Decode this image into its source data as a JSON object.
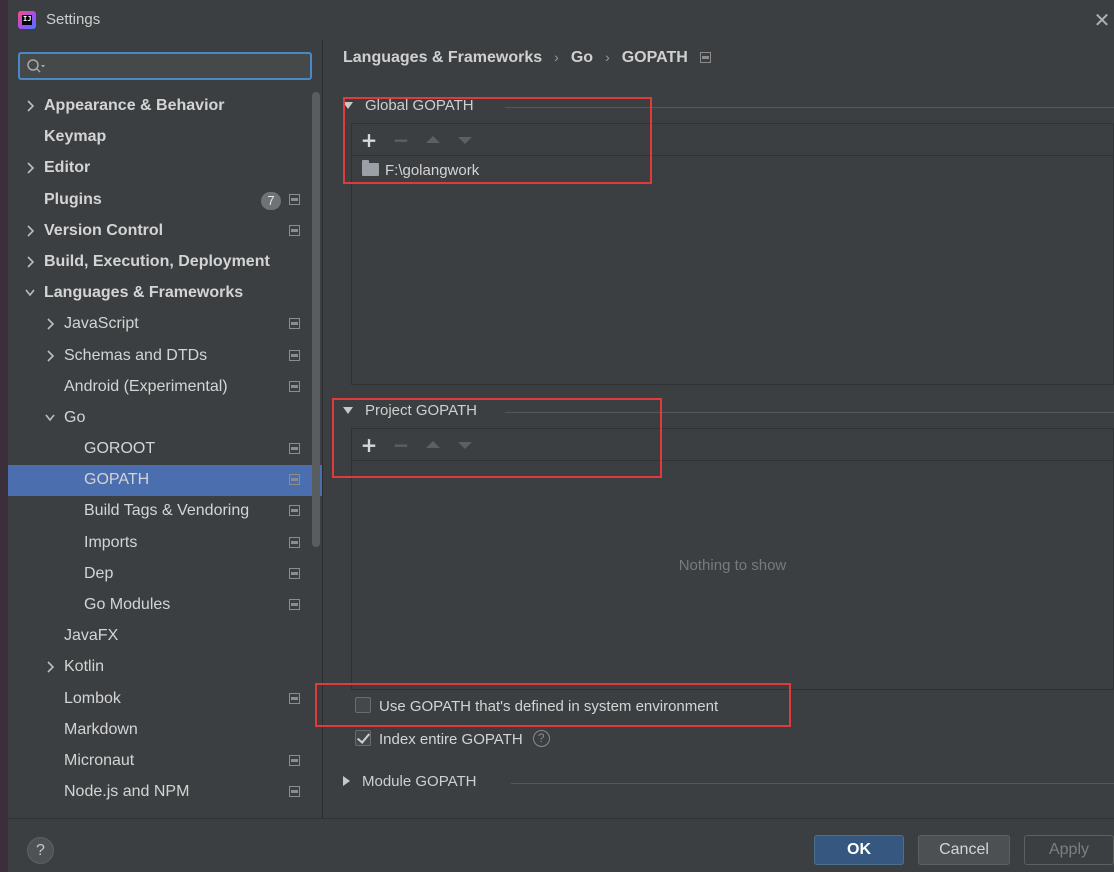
{
  "window": {
    "title": "Settings",
    "logo_text": "IJ"
  },
  "search": {
    "value": "",
    "placeholder": ""
  },
  "sidebar": {
    "items": [
      {
        "label": "Appearance & Behavior",
        "level": 0,
        "arrow": "right",
        "bold": true,
        "proj_icon": false
      },
      {
        "label": "Keymap",
        "level": 0,
        "arrow": "none",
        "bold": true,
        "proj_icon": false
      },
      {
        "label": "Editor",
        "level": 0,
        "arrow": "right",
        "bold": true,
        "proj_icon": false
      },
      {
        "label": "Plugins",
        "level": 0,
        "arrow": "none",
        "bold": true,
        "proj_icon": true,
        "badge": "7"
      },
      {
        "label": "Version Control",
        "level": 0,
        "arrow": "right",
        "bold": true,
        "proj_icon": true
      },
      {
        "label": "Build, Execution, Deployment",
        "level": 0,
        "arrow": "right",
        "bold": true,
        "proj_icon": false
      },
      {
        "label": "Languages & Frameworks",
        "level": 0,
        "arrow": "down",
        "bold": true,
        "proj_icon": false
      },
      {
        "label": "JavaScript",
        "level": 1,
        "arrow": "right",
        "bold": false,
        "proj_icon": true
      },
      {
        "label": "Schemas and DTDs",
        "level": 1,
        "arrow": "right",
        "bold": false,
        "proj_icon": true
      },
      {
        "label": "Android (Experimental)",
        "level": 1,
        "arrow": "none",
        "bold": false,
        "proj_icon": true
      },
      {
        "label": "Go",
        "level": 1,
        "arrow": "down",
        "bold": false,
        "proj_icon": false
      },
      {
        "label": "GOROOT",
        "level": 2,
        "arrow": "none",
        "bold": false,
        "proj_icon": true
      },
      {
        "label": "GOPATH",
        "level": 2,
        "arrow": "none",
        "bold": false,
        "proj_icon": true,
        "selected": true
      },
      {
        "label": "Build Tags & Vendoring",
        "level": 2,
        "arrow": "none",
        "bold": false,
        "proj_icon": true
      },
      {
        "label": "Imports",
        "level": 2,
        "arrow": "none",
        "bold": false,
        "proj_icon": true
      },
      {
        "label": "Dep",
        "level": 2,
        "arrow": "none",
        "bold": false,
        "proj_icon": true
      },
      {
        "label": "Go Modules",
        "level": 2,
        "arrow": "none",
        "bold": false,
        "proj_icon": true
      },
      {
        "label": "JavaFX",
        "level": 1,
        "arrow": "none",
        "bold": false,
        "proj_icon": false
      },
      {
        "label": "Kotlin",
        "level": 1,
        "arrow": "right",
        "bold": false,
        "proj_icon": false
      },
      {
        "label": "Lombok",
        "level": 1,
        "arrow": "none",
        "bold": false,
        "proj_icon": true
      },
      {
        "label": "Markdown",
        "level": 1,
        "arrow": "none",
        "bold": false,
        "proj_icon": false
      },
      {
        "label": "Micronaut",
        "level": 1,
        "arrow": "none",
        "bold": false,
        "proj_icon": true
      },
      {
        "label": "Node.js and NPM",
        "level": 1,
        "arrow": "none",
        "bold": false,
        "proj_icon": true
      }
    ]
  },
  "breadcrumb": {
    "items": [
      "Languages & Frameworks",
      "Go",
      "GOPATH"
    ]
  },
  "global_gopath": {
    "title": "Global GOPATH",
    "entries": [
      "F:\\golangwork"
    ]
  },
  "project_gopath": {
    "title": "Project GOPATH",
    "empty_text": "Nothing to show"
  },
  "options": {
    "use_system_env_label": "Use GOPATH that's defined in system environment",
    "use_system_env_checked": false,
    "index_entire_label": "Index entire GOPATH",
    "index_entire_checked": true
  },
  "module_gopath": {
    "title": "Module GOPATH"
  },
  "footer": {
    "help": "?",
    "ok": "OK",
    "cancel": "Cancel",
    "apply": "Apply"
  },
  "colors": {
    "selection": "#4b6eaf",
    "annotation_red": "#e03a3a",
    "ok_button": "#365880"
  }
}
